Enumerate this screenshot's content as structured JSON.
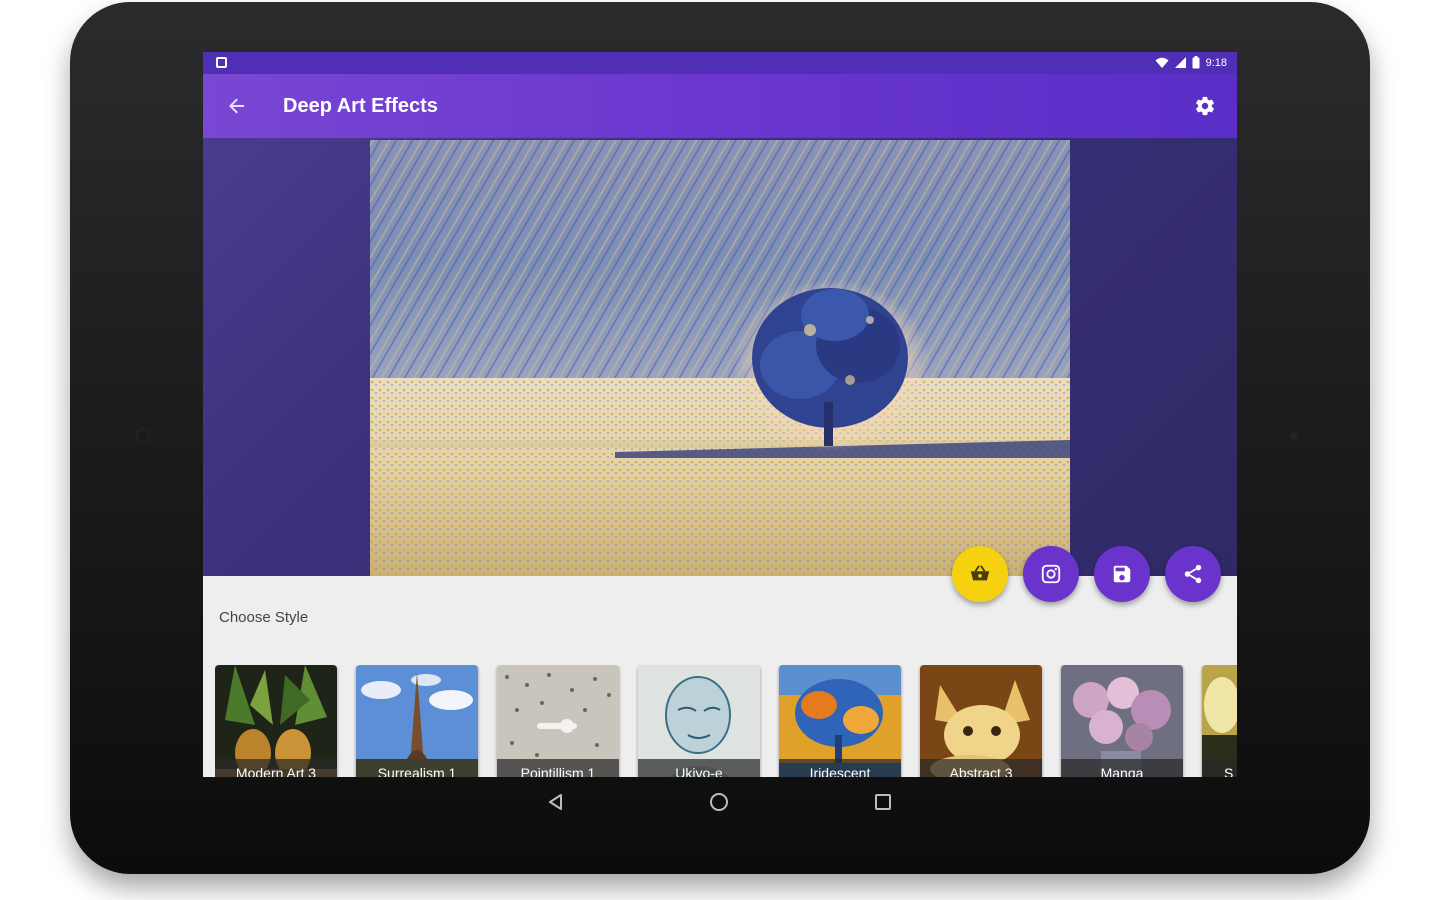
{
  "status_bar": {
    "time": "9:18",
    "icons": [
      "notification-icon",
      "wifi-icon",
      "signal-icon",
      "battery-icon"
    ]
  },
  "app_bar": {
    "title": "Deep Art Effects",
    "back_icon": "arrow-back-icon",
    "settings_icon": "gear-icon"
  },
  "artwork": {
    "description_icon": "stylized-tree-field-image"
  },
  "actions": {
    "shop_icon": "basket-icon",
    "instagram_icon": "instagram-icon",
    "save_icon": "save-icon",
    "share_icon": "share-icon"
  },
  "style_picker": {
    "heading": "Choose Style",
    "styles": [
      {
        "label": "Modern Art 3"
      },
      {
        "label": "Surrealism 1"
      },
      {
        "label": "Pointillism 1"
      },
      {
        "label": "Ukiyo-e"
      },
      {
        "label": "Iridescent"
      },
      {
        "label": "Abstract 3"
      },
      {
        "label": "Manga"
      },
      {
        "label": "S"
      }
    ]
  },
  "colors": {
    "primary": "#6a36cf",
    "accent_yellow": "#f5d10f",
    "fab_purple": "#6a34cc",
    "panel_bg": "#efeeee"
  },
  "nav_bar": {
    "icons": [
      "back-triangle-icon",
      "home-circle-icon",
      "recents-square-icon"
    ]
  }
}
